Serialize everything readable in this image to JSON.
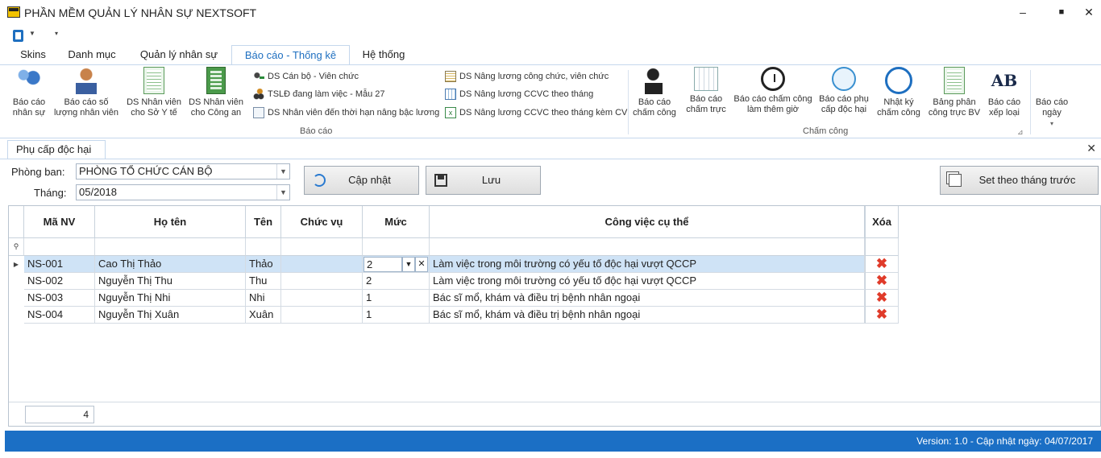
{
  "window": {
    "title": "PHẦN MỀM QUẢN LÝ NHÂN SỰ NEXTSOFT",
    "minimize": "–",
    "maximize": "■",
    "close": "✕"
  },
  "ribbon_tabs": [
    "Skins",
    "Danh mục",
    "Quản lý nhân sự",
    "Báo cáo - Thống kê",
    "Hệ thống"
  ],
  "active_tab": "Báo cáo - Thống kê",
  "ribbon": {
    "bao_cao_group": {
      "label": "Báo cáo",
      "large_buttons": [
        {
          "label": "Báo cáo\nnhân sự",
          "icon": "people-report-icon"
        },
        {
          "label": "Báo cáo số\nlượng nhân viên",
          "icon": "staff-count-icon"
        },
        {
          "label": "DS Nhân viên\ncho Sở Y tế",
          "icon": "spreadsheet-icon"
        },
        {
          "label": "DS Nhân viên\ncho Công an",
          "icon": "spreadsheet-green-icon"
        }
      ],
      "small_buttons": [
        {
          "label": "DS Cán bộ - Viên chức",
          "icon": "staff-list-icon"
        },
        {
          "label": "TSLĐ đang làm việc - Mẫu 27",
          "icon": "workforce-icon"
        },
        {
          "label": "DS Nhân viên đến thời hạn nâng bậc lương",
          "icon": "salary-step-icon"
        },
        {
          "label": "DS Nâng lương công chức, viên chức",
          "icon": "salary-raise-icon"
        },
        {
          "label": "DS Nâng lương CCVC theo tháng",
          "icon": "calendar-sheet-icon"
        },
        {
          "label": "DS Nâng lương CCVC theo tháng kèm CV",
          "icon": "excel-icon"
        }
      ]
    },
    "cham_cong_group": {
      "label": "Chấm công",
      "buttons": [
        {
          "label": "Báo cáo\nchấm công",
          "icon": "timesheet-person-icon"
        },
        {
          "label": "Báo cáo\nchấm trực",
          "icon": "duty-calendar-icon"
        },
        {
          "label": "Báo cáo chấm công\nlàm thêm giờ",
          "icon": "overtime-clock-icon"
        },
        {
          "label": "Báo cáo phụ\ncấp độc hại",
          "icon": "hazard-allowance-icon"
        },
        {
          "label": "Nhật ký\nchấm công",
          "icon": "log-search-icon"
        },
        {
          "label": "Bảng phân\ncông trực BV",
          "icon": "duty-roster-icon"
        },
        {
          "label": "Báo cáo\nxếp loại",
          "icon": "ab-rating-icon"
        }
      ]
    },
    "extra_button": {
      "label": "Báo cáo\nngày",
      "arrow": "▾"
    }
  },
  "document_tab": "Phụ cấp độc hại",
  "form": {
    "department_label": "Phòng ban:",
    "department_value": "PHÒNG TỔ CHỨC CÁN BỘ",
    "month_label": "Tháng:",
    "month_value": "05/2018",
    "update_button": "Cập nhật",
    "save_button": "Lưu",
    "set_prev_button": "Set theo tháng trước"
  },
  "grid": {
    "columns": [
      "Mã NV",
      "Họ tên",
      "Tên",
      "Chức vụ",
      "Mức",
      "Công việc cụ thể",
      "Xóa"
    ],
    "rows": [
      {
        "ma_nv": "NS-001",
        "ho_ten": "Cao Thị Thảo",
        "ten": "Thảo",
        "chuc_vu": "",
        "muc": "2",
        "cong_viec": "Làm việc trong môi trường có yếu tố độc hại vượt QCCP"
      },
      {
        "ma_nv": "NS-002",
        "ho_ten": "Nguyễn Thị Thu",
        "ten": "Thu",
        "chuc_vu": "",
        "muc": "2",
        "cong_viec": "Làm việc trong môi trường có yếu tố độc hại vượt QCCP"
      },
      {
        "ma_nv": "NS-003",
        "ho_ten": "Nguyễn Thị Nhi",
        "ten": "Nhi",
        "chuc_vu": "",
        "muc": "1",
        "cong_viec": "Bác sĩ mổ, khám và điều trị bệnh nhân ngoại"
      },
      {
        "ma_nv": "NS-004",
        "ho_ten": "Nguyễn Thị Xuân",
        "ten": "Xuân",
        "chuc_vu": "",
        "muc": "1",
        "cong_viec": "Bác sĩ mổ, khám và điều trị bệnh nhân ngoại"
      }
    ],
    "record_count": "4"
  },
  "status": "Version: 1.0 - Cập nhật ngày: 04/07/2017",
  "colors": {
    "accent": "#1b6fc5",
    "selected_row": "#cfe3f6",
    "delete": "#e03b2a"
  }
}
